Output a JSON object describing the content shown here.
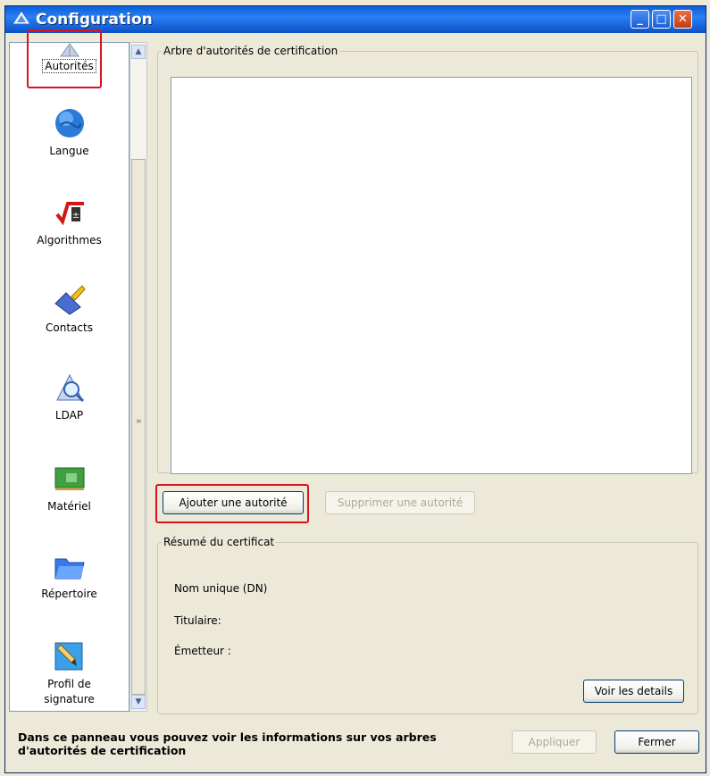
{
  "window": {
    "title": "Configuration",
    "icon": "shield-app-icon",
    "controls": [
      "minimize",
      "maximize",
      "close"
    ]
  },
  "sidebar": {
    "items": [
      {
        "label": "Autorités",
        "icon": "authority-icon",
        "selected": true
      },
      {
        "label": "Langue",
        "icon": "globe-icon"
      },
      {
        "label": "Algorithmes",
        "icon": "algorithm-icon"
      },
      {
        "label": "Contacts",
        "icon": "contacts-icon"
      },
      {
        "label": "LDAP",
        "icon": "ldap-icon"
      },
      {
        "label": "Matériel",
        "icon": "hardware-card-icon"
      },
      {
        "label": "Répertoire",
        "icon": "folder-icon"
      },
      {
        "label": "Profil de signature",
        "label_lines": [
          "Profil de",
          "signature"
        ],
        "icon": "signature-pen-icon"
      }
    ]
  },
  "tree_group": {
    "legend": "Arbre d'autorités de certification"
  },
  "actions": {
    "add": "Ajouter une autorité",
    "remove": "Supprimer une autorité"
  },
  "summary": {
    "legend": "Résumé du certificat",
    "dn": "Nom unique (DN)",
    "holder": "Titulaire:",
    "issuer": "Émetteur :",
    "details_button": "Voir les details"
  },
  "footer": {
    "text": "Dans ce panneau vous pouvez voir les informations sur vos arbres d'autorités de certification",
    "apply": "Appliquer",
    "close": "Fermer"
  },
  "colors": {
    "highlight": "#d8141c",
    "titlebar": "#2a7ff5"
  }
}
